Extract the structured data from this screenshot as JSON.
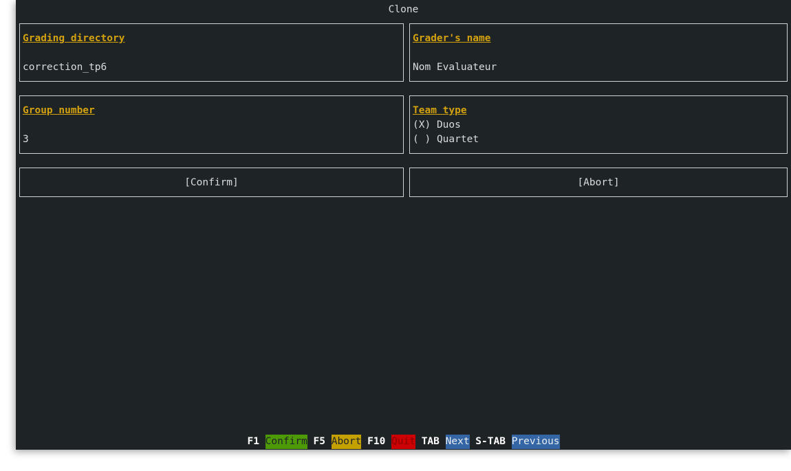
{
  "dialog": {
    "title": "Clone"
  },
  "fields": {
    "grading_directory": {
      "label": "Grading directory",
      "value": "correction_tp6"
    },
    "grader_name": {
      "label": "Grader's name",
      "value": "Nom Evaluateur"
    },
    "group_number": {
      "label": "Group number",
      "value": "3"
    },
    "team_type": {
      "label": "Team type",
      "options": [
        {
          "marker": "(X)",
          "label": "Duos",
          "selected": true
        },
        {
          "marker": "( )",
          "label": "Quartet",
          "selected": false
        }
      ]
    }
  },
  "buttons": {
    "confirm": "[Confirm]",
    "abort": "[Abort]"
  },
  "footer": {
    "items": [
      {
        "key": "F1",
        "action": "Confirm",
        "bg": "#4e9a06",
        "fg": "#1e2326"
      },
      {
        "key": "F5",
        "action": "Abort",
        "bg": "#c4a000",
        "fg": "#1e2326"
      },
      {
        "key": "F10",
        "action": "Quit",
        "bg": "#cc0000",
        "fg": "#8b0000"
      },
      {
        "key": "TAB",
        "action": "Next",
        "bg": "#3465a4",
        "fg": "#e8eef4"
      },
      {
        "key": "S-TAB",
        "action": "Previous",
        "bg": "#3465a4",
        "fg": "#e8eef4"
      }
    ]
  },
  "colors": {
    "background": "#1e2326",
    "label_accent": "#d4a20f",
    "border": "#d0d4d6"
  }
}
